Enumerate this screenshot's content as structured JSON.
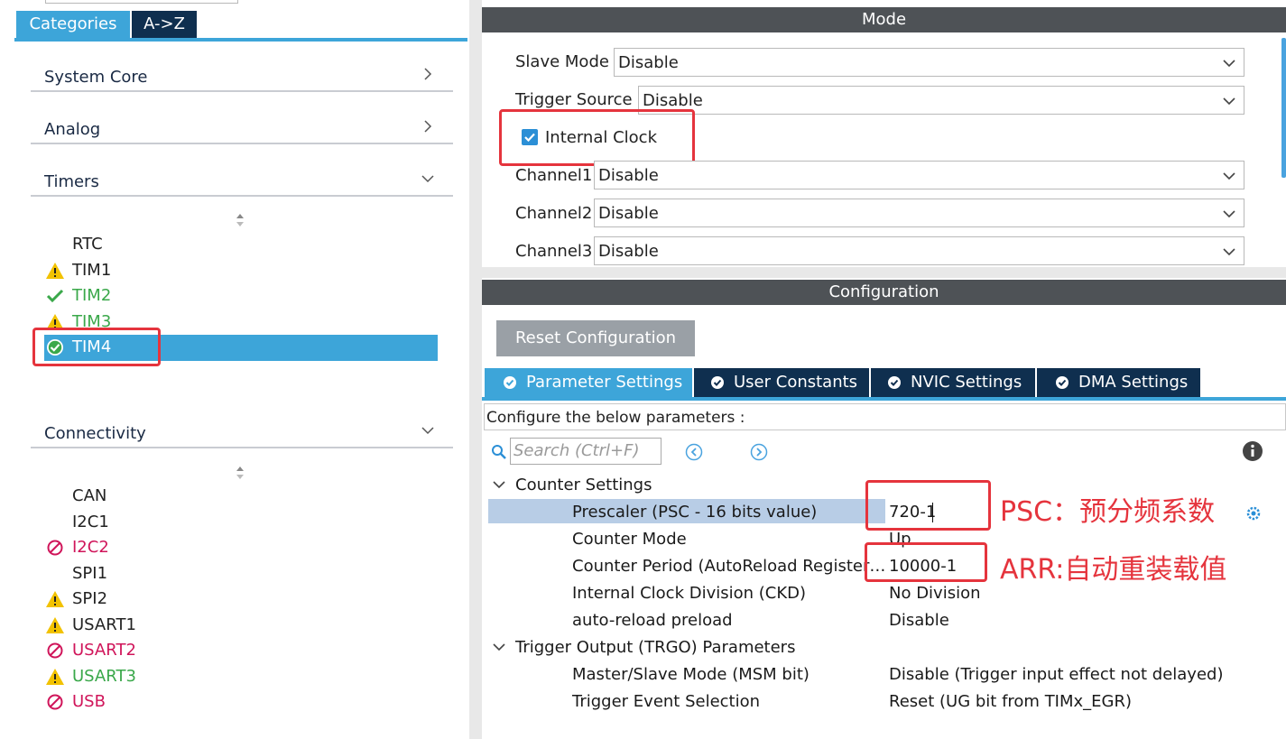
{
  "left_tabs": {
    "categories": "Categories",
    "az": "A->Z"
  },
  "categories": {
    "system_core": "System Core",
    "analog": "Analog",
    "timers": "Timers",
    "connectivity": "Connectivity"
  },
  "timers_items": [
    {
      "label": "RTC",
      "status": "none",
      "color": "#222222"
    },
    {
      "label": "TIM1",
      "status": "warning",
      "color": "#222222"
    },
    {
      "label": "TIM2",
      "status": "ok",
      "color": "#3aa84a"
    },
    {
      "label": "TIM3",
      "status": "warning",
      "color": "#3aa84a"
    },
    {
      "label": "TIM4",
      "status": "ok-selected",
      "color": "#ffffff"
    }
  ],
  "connectivity_items": [
    {
      "label": "CAN",
      "status": "none",
      "color": "#222222"
    },
    {
      "label": "I2C1",
      "status": "none",
      "color": "#222222"
    },
    {
      "label": "I2C2",
      "status": "disabled",
      "color": "#d0155a"
    },
    {
      "label": "SPI1",
      "status": "none",
      "color": "#222222"
    },
    {
      "label": "SPI2",
      "status": "warning",
      "color": "#222222"
    },
    {
      "label": "USART1",
      "status": "warning",
      "color": "#222222"
    },
    {
      "label": "USART2",
      "status": "disabled",
      "color": "#d0155a"
    },
    {
      "label": "USART3",
      "status": "warning",
      "color": "#3aa84a"
    },
    {
      "label": "USB",
      "status": "disabled",
      "color": "#d0155a"
    }
  ],
  "mode": {
    "title": "Mode",
    "slave_mode_label": "Slave Mode",
    "slave_mode_value": "Disable",
    "trigger_source_label": "Trigger Source",
    "trigger_source_value": "Disable",
    "internal_clock_label": "Internal Clock",
    "internal_clock_checked": true,
    "channel1_label": "Channel1",
    "channel1_value": "Disable",
    "channel2_label": "Channel2",
    "channel2_value": "Disable",
    "channel3_label": "Channel3",
    "channel3_value": "Disable"
  },
  "config": {
    "title": "Configuration",
    "reset_button": "Reset Configuration",
    "tabs": [
      "Parameter Settings",
      "User Constants",
      "NVIC Settings",
      "DMA Settings"
    ],
    "description": "Configure the below parameters :",
    "search_placeholder": "Search (Ctrl+F)",
    "counter_settings": "Counter Settings",
    "prescaler_label": "Prescaler (PSC - 16 bits value)",
    "prescaler_value": "720-1",
    "counter_mode_label": "Counter Mode",
    "counter_mode_value": "Up",
    "counter_period_label": "Counter Period (AutoReload Register…",
    "counter_period_value": "10000-1",
    "ckd_label": "Internal Clock Division (CKD)",
    "ckd_value": "No Division",
    "preload_label": "auto-reload preload",
    "preload_value": "Disable",
    "trgo_section": "Trigger Output (TRGO) Parameters",
    "msm_label": "Master/Slave Mode (MSM bit)",
    "msm_value": "Disable (Trigger input effect not delayed)",
    "trgo_event_label": "Trigger Event Selection",
    "trgo_event_value": "Reset (UG bit from TIMx_EGR)"
  },
  "annotations": {
    "psc": "PSC：预分频系数",
    "arr": "ARR:自动重装载值"
  },
  "colors": {
    "accent": "#3da5d9",
    "dark_tab": "#0f2f4f",
    "header": "#4e5256",
    "annotation_red": "#e5343d",
    "ok_green": "#3aa84a",
    "disabled_pink": "#d0155a",
    "warning_yellow": "#f2c200"
  }
}
